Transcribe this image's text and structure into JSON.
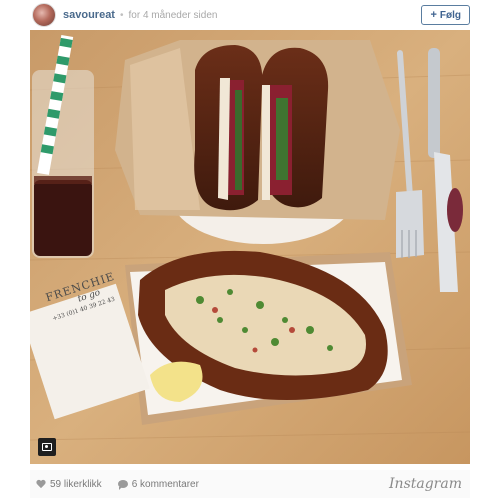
{
  "header": {
    "username": "savoureat",
    "separator": "•",
    "time": "for 4 måneder siden",
    "follow_plus": "+",
    "follow_label": "Følg"
  },
  "photo": {
    "card_lines": [
      "FRENCHIE",
      "to go",
      "+33 (0)1 40 39 22 43"
    ]
  },
  "footer": {
    "likes": "59 likerklikk",
    "comments": "6 kommentarer",
    "brand": "Instagram"
  },
  "colors": {
    "link": "#4a6a8c",
    "follow_border": "#5a7da0",
    "table_wood": "#d7ad7a"
  }
}
